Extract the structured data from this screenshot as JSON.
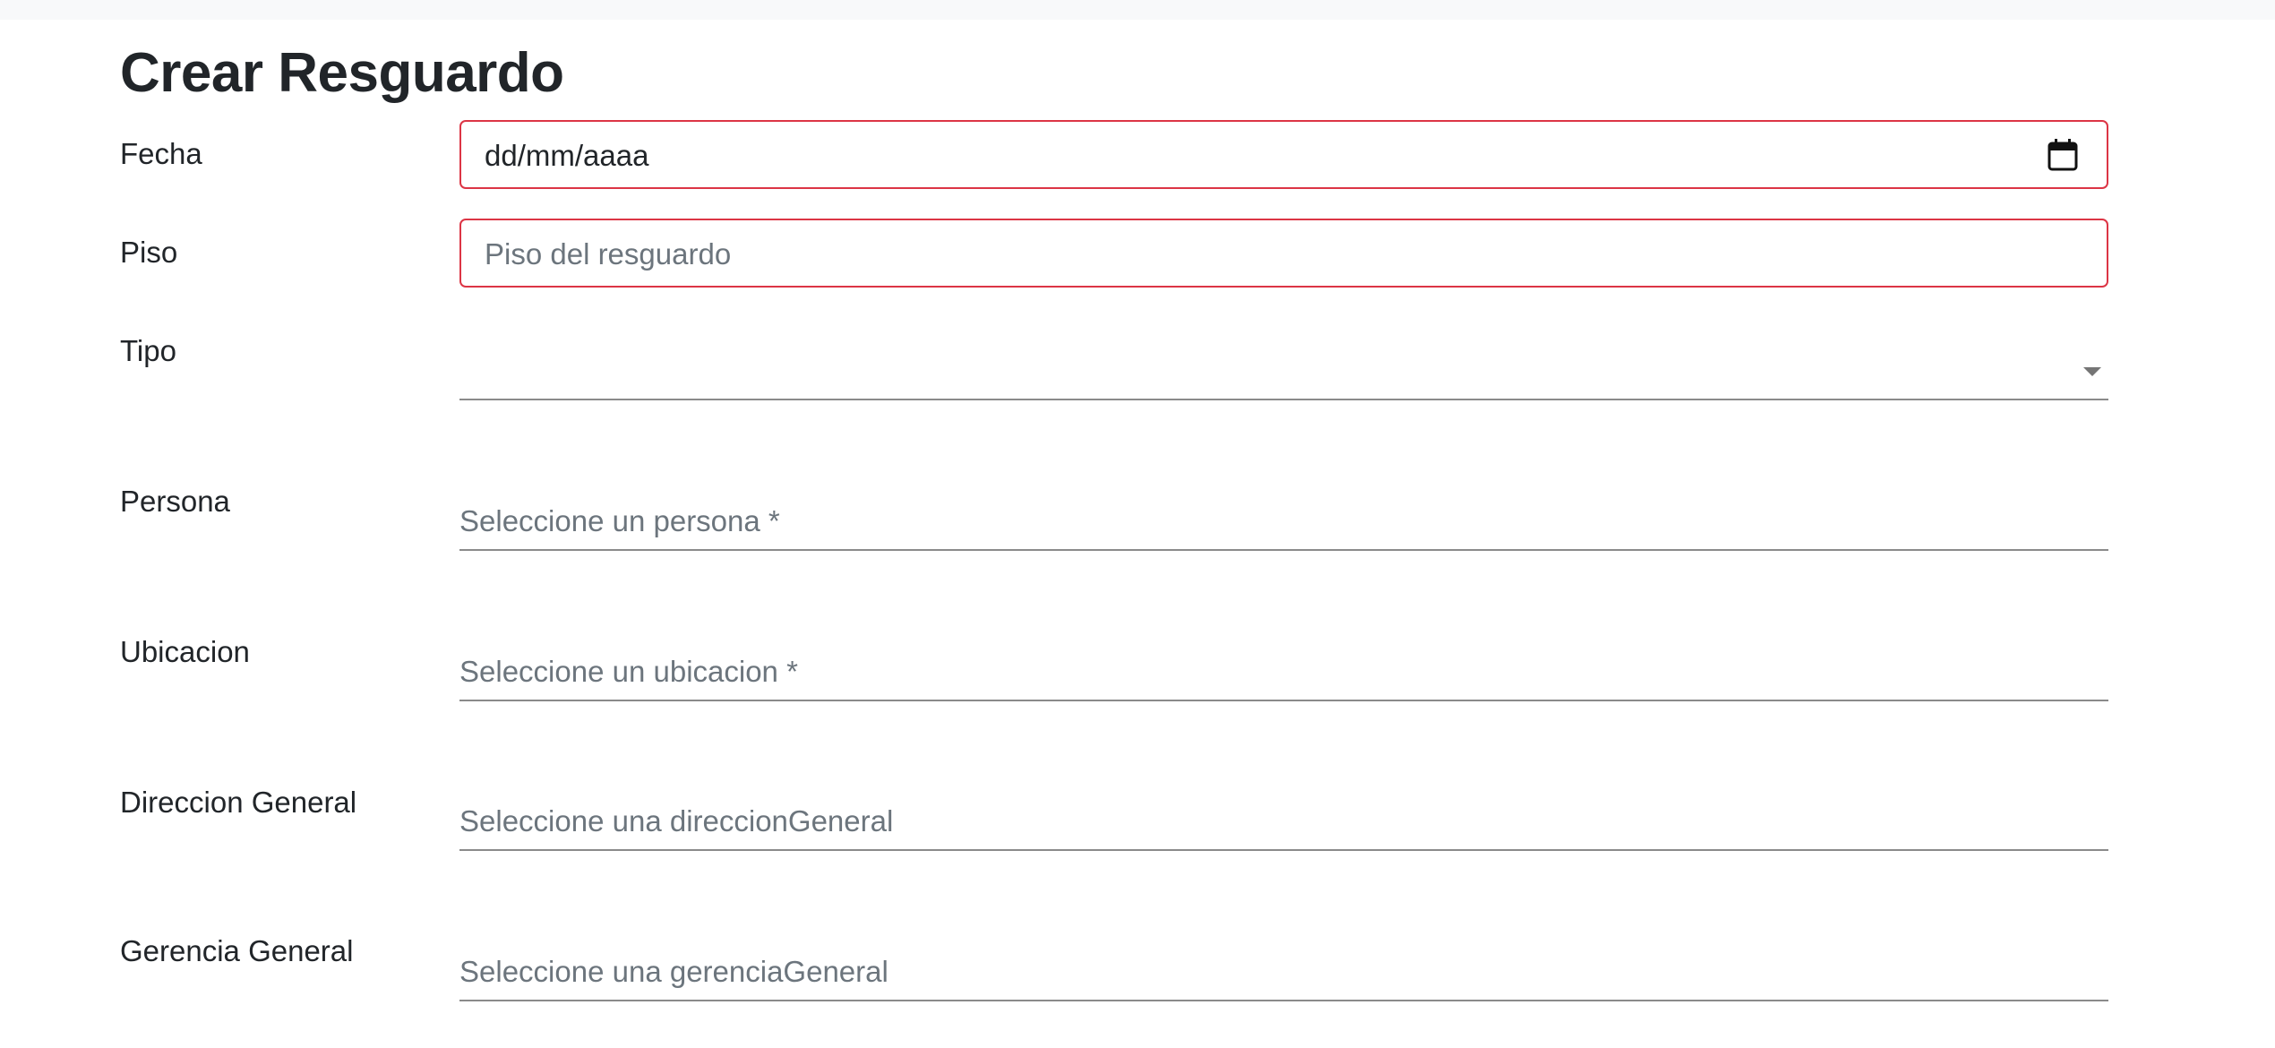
{
  "page": {
    "title": "Crear Resguardo"
  },
  "form": {
    "fecha": {
      "label": "Fecha",
      "value": "dd/mm/aaaa",
      "icon": "calendar-icon"
    },
    "piso": {
      "label": "Piso",
      "placeholder": "Piso del resguardo"
    },
    "tipo": {
      "label": "Tipo",
      "value": "",
      "icon": "chevron-down-icon"
    },
    "persona": {
      "label": "Persona",
      "placeholder": "Seleccione un persona *"
    },
    "ubicacion": {
      "label": "Ubicacion",
      "placeholder": "Seleccione un ubicacion *"
    },
    "direccion_general": {
      "label": "Direccion General",
      "placeholder": "Seleccione una direccionGeneral"
    },
    "gerencia_general": {
      "label": "Gerencia General",
      "placeholder": "Seleccione una gerenciaGeneral"
    }
  },
  "colors": {
    "invalid_border": "#dc3545",
    "placeholder": "#6c757d",
    "text": "#212529",
    "underline": "#8a8a8a",
    "top_strip": "#f8f9fa"
  }
}
